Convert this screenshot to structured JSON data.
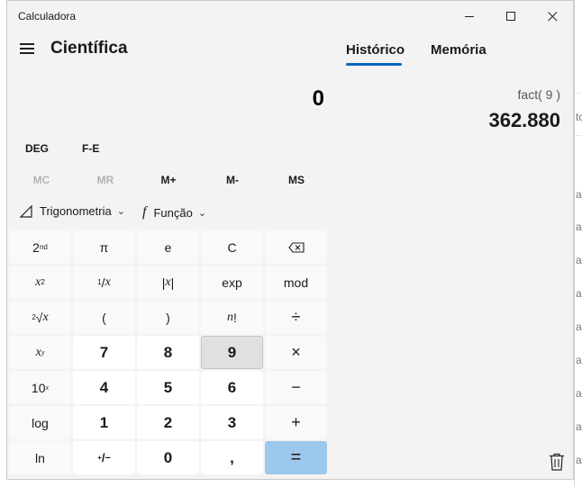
{
  "window": {
    "title": "Calculadora"
  },
  "titlebar": {
    "minimize_icon": "minimize-icon",
    "maximize_icon": "maximize-icon",
    "close_icon": "close-icon"
  },
  "header": {
    "mode": "Científica",
    "tabs": [
      {
        "label": "Histórico",
        "active": true
      },
      {
        "label": "Memória",
        "active": false
      }
    ]
  },
  "display": {
    "value": "0"
  },
  "angle": {
    "deg": "DEG",
    "fe": "F-E"
  },
  "memory": {
    "mc": "MC",
    "mr": "MR",
    "mplus": "M+",
    "mminus": "M-",
    "ms": "MS"
  },
  "functions": {
    "trig": "Trigonometria",
    "func": "Função"
  },
  "keys": {
    "row1": [
      "2nd",
      "π",
      "e",
      "C",
      "⌫"
    ],
    "row2": [
      "x²",
      "¹⁄x",
      "|x|",
      "exp",
      "mod"
    ],
    "row3": [
      "²√x",
      "(",
      ")",
      "n!",
      "÷"
    ],
    "row4": [
      "xʸ",
      "7",
      "8",
      "9",
      "×"
    ],
    "row5": [
      "10ˣ",
      "4",
      "5",
      "6",
      "−"
    ],
    "row6": [
      "log",
      "1",
      "2",
      "3",
      "+"
    ],
    "row7": [
      "ln",
      "+/−",
      "0",
      ",",
      "="
    ]
  },
  "history": {
    "expression": "fact( 9 )",
    "result": "362.880"
  },
  "background_app": {
    "fragments": [
      "to",
      "a",
      "a",
      "a",
      "a",
      "a",
      "a",
      "a",
      "a",
      "a"
    ]
  },
  "colors": {
    "accent": "#0067c0",
    "equals": "#9dc8ed",
    "window_bg": "#f3f3f3",
    "pressed_key": "#e0e0e0"
  }
}
